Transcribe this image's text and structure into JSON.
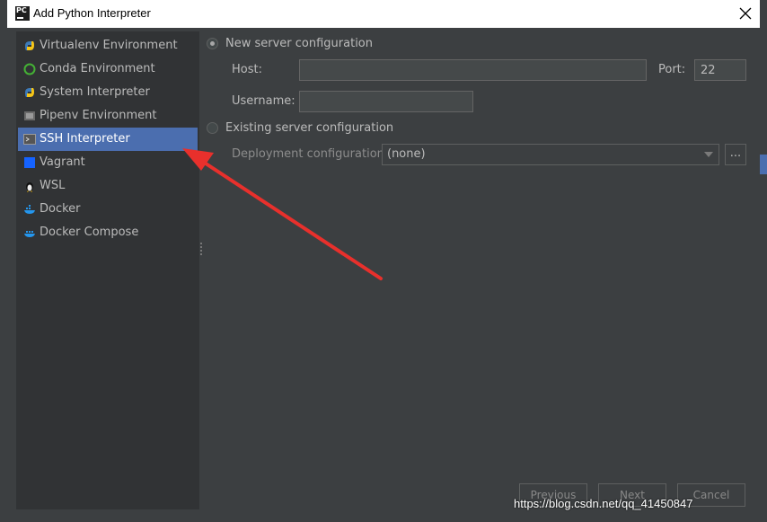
{
  "window": {
    "title": "Add Python Interpreter",
    "app_icon": "PC"
  },
  "sidebar": {
    "items": [
      {
        "label": "Virtualenv Environment",
        "icon": "python-icon",
        "selected": false
      },
      {
        "label": "Conda Environment",
        "icon": "conda-icon",
        "selected": false
      },
      {
        "label": "System Interpreter",
        "icon": "python-icon",
        "selected": false
      },
      {
        "label": "Pipenv Environment",
        "icon": "pipenv-icon",
        "selected": false
      },
      {
        "label": "SSH Interpreter",
        "icon": "terminal-icon",
        "selected": true
      },
      {
        "label": "Vagrant",
        "icon": "vagrant-icon",
        "selected": false
      },
      {
        "label": "WSL",
        "icon": "linux-penguin-icon",
        "selected": false
      },
      {
        "label": "Docker",
        "icon": "docker-icon",
        "selected": false
      },
      {
        "label": "Docker Compose",
        "icon": "docker-compose-icon",
        "selected": false
      }
    ]
  },
  "ssh": {
    "new_server_label": "New server configuration",
    "new_server_selected": true,
    "host_label": "Host:",
    "host_value": "",
    "port_label": "Port:",
    "port_value": "22",
    "username_label": "Username:",
    "username_value": "",
    "existing_server_label": "Existing server configuration",
    "existing_server_selected": false,
    "deployment_label": "Deployment configuration:",
    "deployment_value": "(none)",
    "browse_label": "..."
  },
  "buttons": {
    "previous": "Previous",
    "next": "Next",
    "cancel": "Cancel"
  },
  "watermark": "https://blog.csdn.net/qq_41450847",
  "colors": {
    "selection": "#4b6eaf",
    "annotation_arrow": "#e8302c"
  }
}
